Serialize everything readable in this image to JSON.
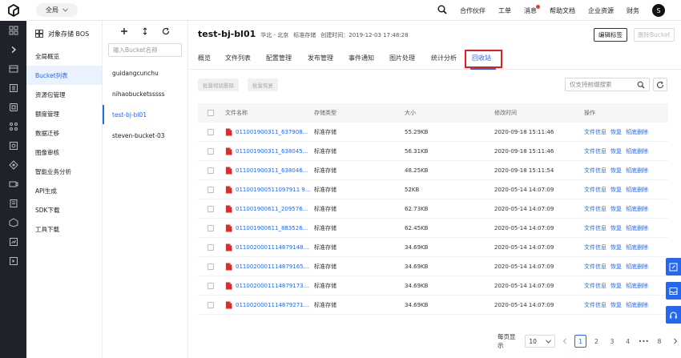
{
  "topbar": {
    "region": "全局",
    "nav": [
      "合作伙伴",
      "工单",
      "消息",
      "帮助文档",
      "企业资源",
      "财务"
    ],
    "avatar": "S"
  },
  "sidebar": {
    "title": "对象存储 BOS",
    "items": [
      "全局概览",
      "Bucket列表",
      "资源包管理",
      "额度管理",
      "数据迁移",
      "图像审核",
      "智能业务分析",
      "API生成",
      "SDK下载",
      "工具下载"
    ]
  },
  "bucketlist": {
    "search_placeholder": "输入Bucket名称",
    "items": [
      "guidangcunchu",
      "nihaobucketsssss",
      "test-bj-bl01",
      "steven-bucket-03"
    ]
  },
  "main": {
    "bucket_name": "test-bj-bl01",
    "region": "华北 - 北京",
    "storage": "标准存储",
    "created": "创建时间：2019-12-03 17:48:28",
    "edit_tags": "编辑标签",
    "delete_bucket": "删除Bucket",
    "tabs": [
      "概览",
      "文件列表",
      "配置管理",
      "发布管理",
      "事件通知",
      "图片处理",
      "统计分析",
      "回收站"
    ],
    "batch_delete": "批量彻底删除",
    "batch_restore": "批量恢复",
    "prefix_placeholder": "仅支持前缀搜索"
  },
  "table": {
    "headers": [
      "文件名称",
      "存储类型",
      "大小",
      "修改时间",
      "操作"
    ],
    "rows": [
      {
        "name": "011001900311_637908...",
        "type": "标准存储",
        "size": "55.29KB",
        "time": "2020-09-18 15:11:46"
      },
      {
        "name": "011001900311_638045...",
        "type": "标准存储",
        "size": "56.31KB",
        "time": "2020-09-18 15:11:46"
      },
      {
        "name": "011001900311_638046...",
        "type": "标准存储",
        "size": "48.25KB",
        "time": "2020-09-18 15:11:54"
      },
      {
        "name": "011001900511097911 9...",
        "type": "标准存储",
        "size": "52KB",
        "time": "2020-05-14 14:07:09"
      },
      {
        "name": "011001900611_209576...",
        "type": "标准存储",
        "size": "62.73KB",
        "time": "2020-05-14 14:07:09"
      },
      {
        "name": "011001900611_883526...",
        "type": "标准存储",
        "size": "62.45KB",
        "time": "2020-05-14 14:07:09"
      },
      {
        "name": "0110020001114879148...",
        "type": "标准存储",
        "size": "34.69KB",
        "time": "2020-05-14 14:07:09"
      },
      {
        "name": "0110020001114879165...",
        "type": "标准存储",
        "size": "34.69KB",
        "time": "2020-05-14 14:07:09"
      },
      {
        "name": "0110020001114879173...",
        "type": "标准存储",
        "size": "34.69KB",
        "time": "2020-05-14 14:07:09"
      },
      {
        "name": "0110020001114879271...",
        "type": "标准存储",
        "size": "34.69KB",
        "time": "2020-05-14 14:07:09"
      }
    ],
    "ops": [
      "文件信息",
      "恢复",
      "彻底删除"
    ]
  },
  "pager": {
    "per_page_label": "每页显示",
    "per_page": "10",
    "pages": [
      "1",
      "2",
      "3",
      "4",
      "•••",
      "8"
    ]
  }
}
